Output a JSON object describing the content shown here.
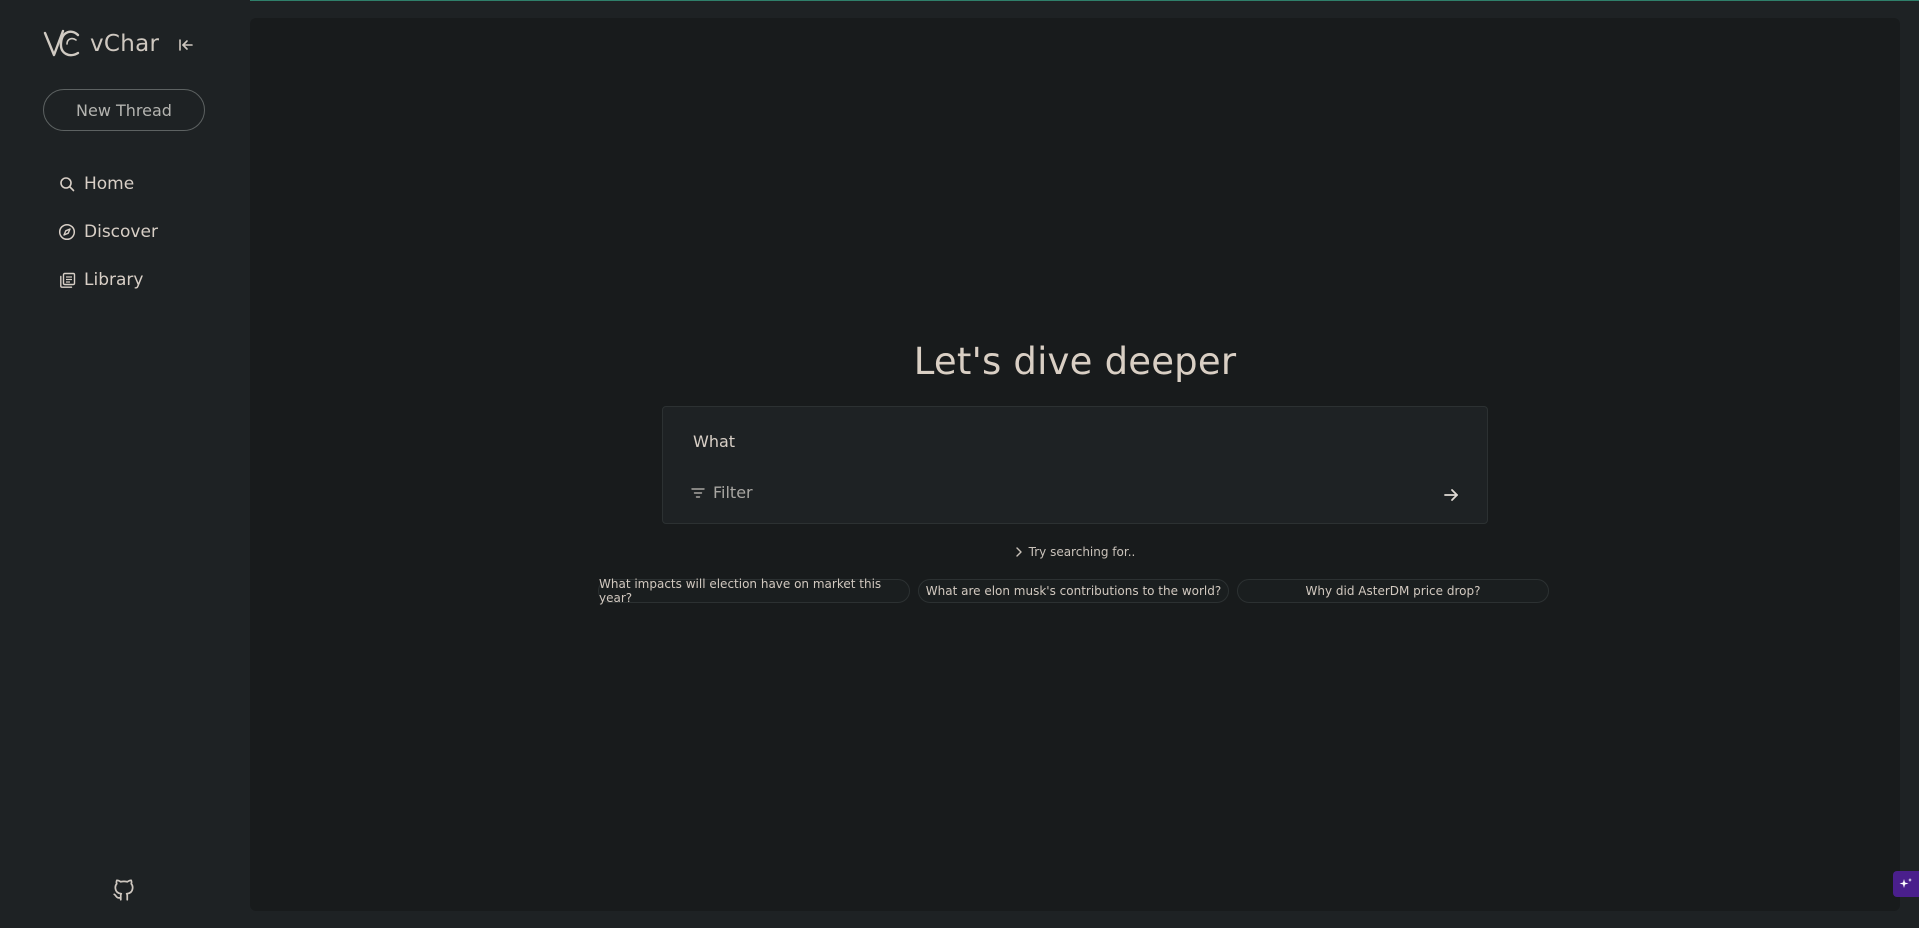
{
  "app": {
    "name": "vChar"
  },
  "sidebar": {
    "new_thread_label": "New Thread",
    "items": [
      {
        "label": "Home",
        "icon": "search-icon"
      },
      {
        "label": "Discover",
        "icon": "compass-icon"
      },
      {
        "label": "Library",
        "icon": "library-icon"
      }
    ],
    "footer_icon": "github-icon"
  },
  "main": {
    "hero_title": "Let's dive deeper",
    "search": {
      "value": "What",
      "filter_label": "Filter"
    },
    "try_label": "Try searching for..",
    "suggestions": [
      "What impacts will election have on market this year?",
      "What are elon musk's contributions to the world?",
      "Why did AsterDM price drop?"
    ]
  },
  "colors": {
    "background": "#181b1c",
    "sidebar": "#1e2224",
    "text": "#d8cfc6",
    "accent": "#4a1f8c"
  }
}
